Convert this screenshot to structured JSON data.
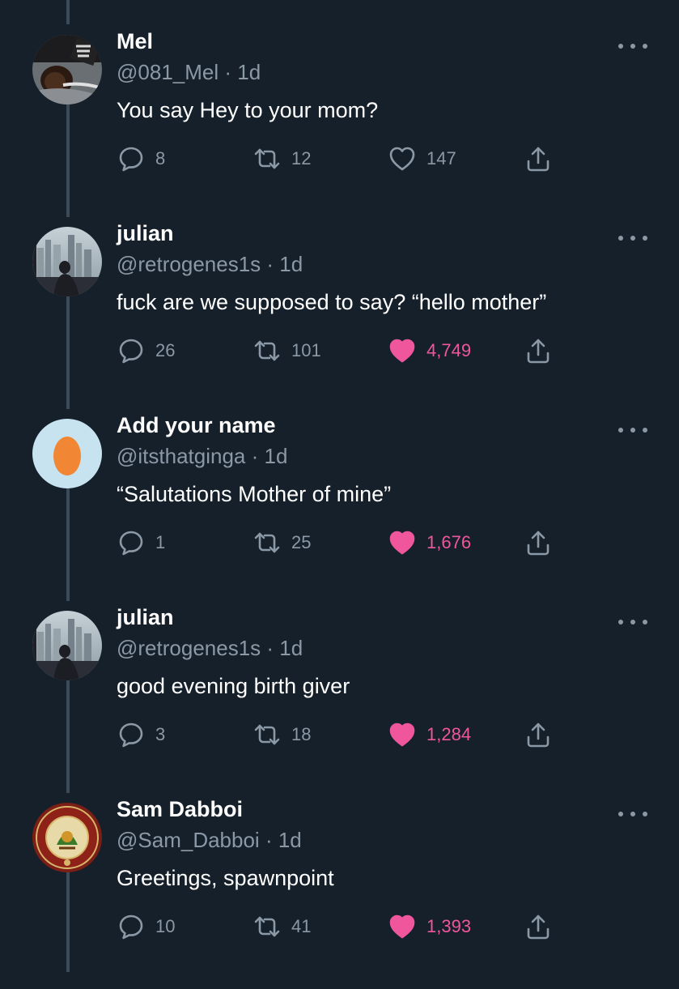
{
  "thread": {
    "tweets": [
      {
        "name": "Mel",
        "handle": "@081_Mel",
        "time": "1d",
        "text": "You say Hey to your mom?",
        "replies": "8",
        "retweets": "12",
        "likes": "147",
        "liked": false,
        "avatar": "photo-avatar-person"
      },
      {
        "name": "julian",
        "handle": "@retrogenes1s",
        "time": "1d",
        "text": "fuck are we supposed to say? “hello mother”",
        "replies": "26",
        "retweets": "101",
        "likes": "4,749",
        "liked": true,
        "avatar": "photo-avatar-city"
      },
      {
        "name": "Add your name",
        "handle": "@itsthatginga",
        "time": "1d",
        "text": "“Salutations Mother of mine”",
        "replies": "1",
        "retweets": "25",
        "likes": "1,676",
        "liked": true,
        "avatar": "egg-avatar"
      },
      {
        "name": "julian",
        "handle": "@retrogenes1s",
        "time": "1d",
        "text": "good evening birth giver",
        "replies": "3",
        "retweets": "18",
        "likes": "1,284",
        "liked": true,
        "avatar": "photo-avatar-city"
      },
      {
        "name": "Sam Dabboi",
        "handle": "@Sam_Dabboi",
        "time": "1d",
        "text": "Greetings, spawnpoint",
        "replies": "10",
        "retweets": "41",
        "likes": "1,393",
        "liked": true,
        "avatar": "railway-crest-avatar"
      }
    ]
  },
  "colors": {
    "background": "#15202b",
    "secondary_text": "#8b98a5",
    "like_active": "#f0569c",
    "thread_line": "#3a4a58"
  }
}
